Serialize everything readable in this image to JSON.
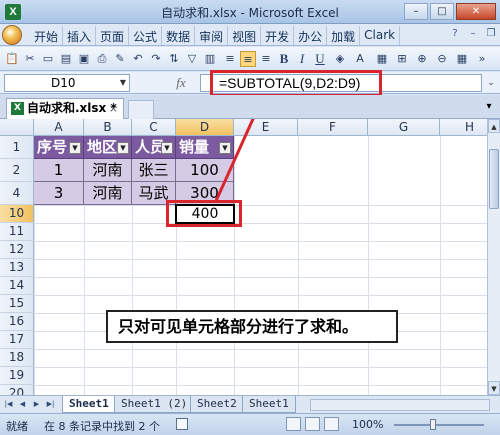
{
  "window": {
    "title": "自动求和.xlsx - Microsoft Excel",
    "app_icon": "X",
    "controls": [
      "–",
      "□",
      "✕"
    ]
  },
  "ribbon": {
    "tabs": [
      "开始",
      "插入",
      "页面",
      "公式",
      "数据",
      "审阅",
      "视图",
      "开发",
      "办公",
      "加载",
      "Clark"
    ]
  },
  "toolbar": {
    "bold": "B",
    "italic": "I",
    "underline": "U"
  },
  "formula_bar": {
    "name_box": "D10",
    "fx": "fx",
    "formula": "=SUBTOTAL(9,D2:D9)"
  },
  "workbook_tab": {
    "label": "自动求和.xlsx *",
    "close": "×"
  },
  "grid": {
    "columns": [
      "A",
      "B",
      "C",
      "D",
      "E",
      "F",
      "G",
      "H"
    ],
    "selected_column": "D",
    "rows": [
      "1",
      "2",
      "4",
      "10",
      "11",
      "12",
      "13",
      "14",
      "15",
      "16",
      "17",
      "18",
      "19",
      "20",
      "21",
      "22"
    ],
    "selected_row": "10",
    "headers": [
      "序号",
      "地区",
      "人员",
      "销量"
    ],
    "data": [
      [
        "1",
        "河南",
        "张三",
        "100"
      ],
      [
        "3",
        "河南",
        "马武",
        "300"
      ]
    ],
    "result": "400"
  },
  "annotation": {
    "note": "只对可见单元格部分进行了求和。"
  },
  "sheets": [
    "Sheet1",
    "Sheet1 (2)",
    "Sheet2",
    "Sheet1"
  ],
  "active_sheet_index": 0,
  "status": {
    "mode": "就绪",
    "filter_info": "在 8 条记录中找到 2 个",
    "zoom_level": "100%"
  },
  "colors": {
    "header_fill": "#7c5aa0",
    "data_fill": "#d6cbe4",
    "highlight_red": "#d8262c"
  }
}
